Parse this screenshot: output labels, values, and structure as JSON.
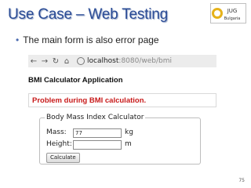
{
  "slide": {
    "title": "Use Case – Web Testing",
    "bullet": "The main form is also error page",
    "page_number": "75"
  },
  "logo": {
    "top": "JUG",
    "bottom": "Bulgaria"
  },
  "browser": {
    "back_icon": "back-arrow-icon",
    "forward_icon": "forward-arrow-icon",
    "reload_icon": "reload-icon",
    "home_icon": "home-icon",
    "host": "localhost",
    "path": ":8080/web/bmi"
  },
  "app": {
    "title": "BMI Calculator Application",
    "error": "Problem during BMI calculation.",
    "legend": "Body Mass Index Calculator",
    "mass_label": "Mass:",
    "mass_value": "77",
    "mass_unit": "kg",
    "height_label": "Height:",
    "height_value": "",
    "height_unit": "m",
    "calculate_label": "Calculate"
  },
  "colors": {
    "title": "#2b4c96",
    "error": "#c81a1a"
  }
}
